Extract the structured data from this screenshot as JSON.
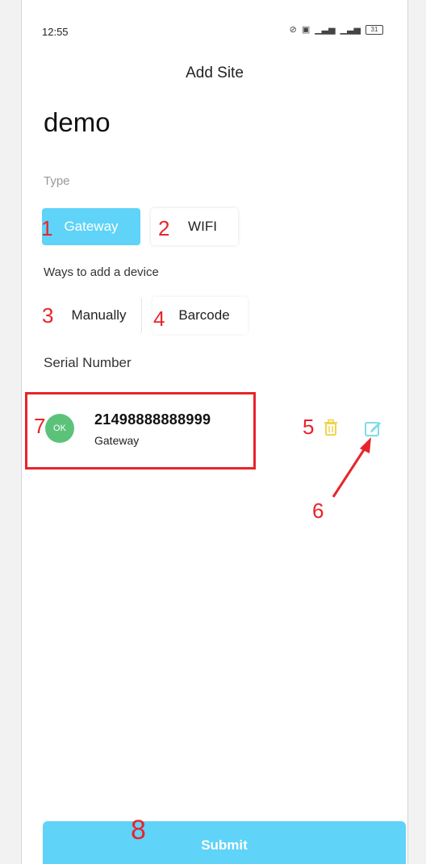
{
  "status_bar": {
    "time": "12:55",
    "icons": [
      "mute-icon",
      "hd-icon",
      "signal-icon",
      "signal-icon",
      "battery-icon"
    ],
    "battery_level": "31"
  },
  "header": {
    "title": "Add Site"
  },
  "site": {
    "name": "demo"
  },
  "type_section": {
    "label": "Type",
    "options": [
      {
        "label": "Gateway",
        "selected": true
      },
      {
        "label": "WIFI",
        "selected": false
      }
    ]
  },
  "ways_section": {
    "label": "Ways to add a device",
    "options": [
      {
        "label": "Manually"
      },
      {
        "label": "Barcode"
      }
    ]
  },
  "serial_section": {
    "label": "Serial Number",
    "device": {
      "status": "OK",
      "serial": "21498888888999",
      "type": "Gateway"
    }
  },
  "annotations": [
    "1",
    "2",
    "3",
    "4",
    "5",
    "6",
    "7",
    "8"
  ],
  "submit": {
    "label": "Submit"
  },
  "colors": {
    "accent": "#5fd3f8",
    "status_ok": "#5cc27a",
    "annotation": "#e8242a",
    "delete_icon": "#f1d34b",
    "edit_icon": "#7ddbe9"
  }
}
